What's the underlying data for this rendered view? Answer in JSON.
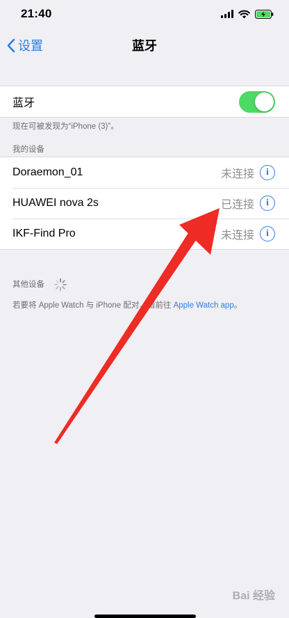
{
  "status_bar": {
    "time": "21:40"
  },
  "nav": {
    "back_label": "设置",
    "title": "蓝牙"
  },
  "bluetooth": {
    "label": "蓝牙",
    "enabled": true,
    "discoverable_note": "现在可被发现为“iPhone (3)”。"
  },
  "my_devices": {
    "header": "我的设备",
    "items": [
      {
        "name": "Doraemon_01",
        "status": "未连接"
      },
      {
        "name": "HUAWEI nova 2s",
        "status": "已连接"
      },
      {
        "name": "IKF-Find Pro",
        "status": "未连接"
      }
    ]
  },
  "other_devices": {
    "header": "其他设备",
    "note_prefix": "若要将 Apple Watch 与 iPhone 配对，请前往 ",
    "note_link": "Apple Watch app",
    "note_suffix": "。"
  },
  "watermark": "Bai 经验",
  "colors": {
    "accent": "#2f7de1",
    "toggle_on": "#4cd964",
    "annotation_arrow": "#ee2b24"
  },
  "icons": {
    "back": "chevron-left-icon",
    "info": "info-icon",
    "signal": "cellular-signal-icon",
    "wifi": "wifi-icon",
    "battery": "battery-charging-icon",
    "spinner": "loading-spinner-icon",
    "annotation": "red-arrow-annotation"
  }
}
